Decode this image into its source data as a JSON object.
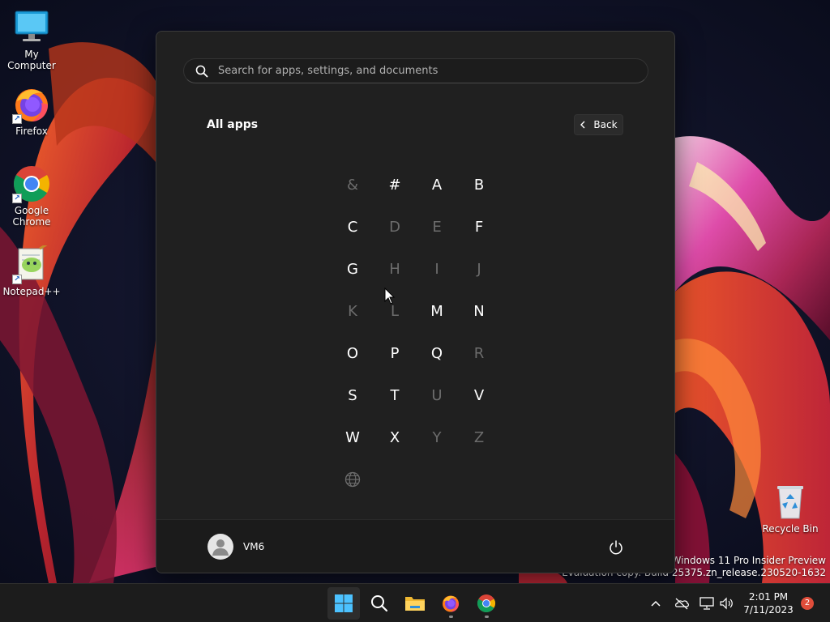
{
  "desktop": {
    "icons": [
      {
        "label": "My Computer",
        "icon": "monitor-icon"
      },
      {
        "label": "Firefox",
        "icon": "firefox-icon"
      },
      {
        "label": "Google Chrome",
        "icon": "chrome-icon"
      },
      {
        "label": "Notepad++",
        "icon": "notepadpp-icon"
      },
      {
        "label": "Recycle Bin",
        "icon": "recycle-bin-icon"
      }
    ],
    "watermark": {
      "line1": "Windows 11 Pro Insider Preview",
      "line2": "Evaluation copy. Build 25375.zn_release.230520-1632"
    }
  },
  "start_menu": {
    "search_placeholder": "Search for apps, settings, and documents",
    "section_title": "All apps",
    "back_label": "Back",
    "letters": [
      {
        "label": "&",
        "enabled": false
      },
      {
        "label": "#",
        "enabled": true
      },
      {
        "label": "A",
        "enabled": true
      },
      {
        "label": "B",
        "enabled": true
      },
      {
        "label": "C",
        "enabled": true
      },
      {
        "label": "D",
        "enabled": false
      },
      {
        "label": "E",
        "enabled": false
      },
      {
        "label": "F",
        "enabled": true
      },
      {
        "label": "G",
        "enabled": true
      },
      {
        "label": "H",
        "enabled": false
      },
      {
        "label": "I",
        "enabled": false
      },
      {
        "label": "J",
        "enabled": false
      },
      {
        "label": "K",
        "enabled": false
      },
      {
        "label": "L",
        "enabled": false
      },
      {
        "label": "M",
        "enabled": true
      },
      {
        "label": "N",
        "enabled": true
      },
      {
        "label": "O",
        "enabled": true
      },
      {
        "label": "P",
        "enabled": true
      },
      {
        "label": "Q",
        "enabled": true
      },
      {
        "label": "R",
        "enabled": false
      },
      {
        "label": "S",
        "enabled": true
      },
      {
        "label": "T",
        "enabled": true
      },
      {
        "label": "U",
        "enabled": false
      },
      {
        "label": "V",
        "enabled": true
      },
      {
        "label": "W",
        "enabled": true
      },
      {
        "label": "X",
        "enabled": true
      },
      {
        "label": "Y",
        "enabled": false
      },
      {
        "label": "Z",
        "enabled": false
      },
      {
        "label": "",
        "enabled": false,
        "icon": "globe-icon"
      }
    ],
    "user": {
      "name": "VM6"
    }
  },
  "taskbar": {
    "apps": [
      "start-icon",
      "search-icon",
      "file-explorer-icon",
      "firefox-icon",
      "chrome-icon"
    ],
    "tray": [
      "chevron-up-icon",
      "onedrive-icon",
      "network-icon",
      "volume-icon"
    ],
    "time": "2:01 PM",
    "date": "7/11/2023",
    "notification_count": "2"
  },
  "colors": {
    "accent": "#4cc2ff",
    "menu_bg": "#202020",
    "taskbar_bg": "#1c1c1c",
    "disabled_letter": "#6c6c6c",
    "badge": "#e04d3a"
  }
}
